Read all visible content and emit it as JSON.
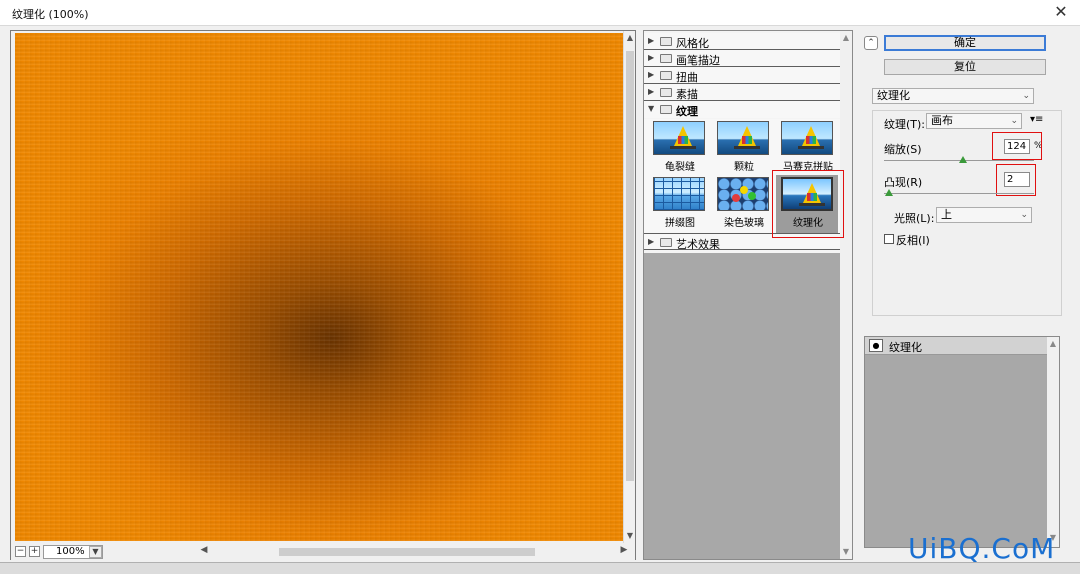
{
  "window": {
    "title": "纹理化 (100%)",
    "close_glyph": "✕"
  },
  "preview": {
    "zoom_value": "100%",
    "zoom_out_glyph": "−",
    "zoom_in_glyph": "+"
  },
  "filter_list": {
    "categories": [
      {
        "label": "风格化"
      },
      {
        "label": "画笔描边"
      },
      {
        "label": "扭曲"
      },
      {
        "label": "素描"
      },
      {
        "label": "纹理"
      },
      {
        "label": "艺术效果"
      }
    ],
    "texture_filters": [
      {
        "label": "龟裂缝"
      },
      {
        "label": "颗粒"
      },
      {
        "label": "马赛克拼贴"
      },
      {
        "label": "拼缀图"
      },
      {
        "label": "染色玻璃"
      },
      {
        "label": "纹理化"
      }
    ],
    "selected_filter": "纹理化"
  },
  "settings": {
    "ok_label": "确定",
    "reset_label": "复位",
    "filter_select": "纹理化",
    "texture_label": "纹理(T):",
    "texture_value": "画布",
    "scaling_label": "缩放(S)",
    "scaling_value": "124",
    "scaling_unit": "%",
    "relief_label": "凸现(R)",
    "relief_value": "2",
    "light_label": "光照(L):",
    "light_value": "上",
    "invert_label": "反相(I)"
  },
  "effect_layers": {
    "items": [
      {
        "label": "纹理化"
      }
    ]
  },
  "watermark": "UiBQ.CoM"
}
